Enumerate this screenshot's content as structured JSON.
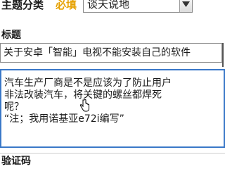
{
  "form": {
    "topic_label": "主题分类",
    "required_label": "必填",
    "topic_select": {
      "value": "谈天说地"
    },
    "title_label": "标题",
    "title_input": {
      "value": "关于安卓「智能」电视不能安装自己的软件"
    },
    "body_lines": [
      "汽车生产厂商是不是应该为了防止用户",
      "非法改装汽车，将关键的螺丝都焊死",
      "呢？",
      "“注；我用诺基亚e72i编写”"
    ],
    "captcha_label": "验证码"
  },
  "colors": {
    "required": "#e6a100",
    "focus_border": "#3a78c8"
  },
  "icons": {
    "select_arrow": "chevron-down-icon",
    "cursor": "hand-pointer-icon"
  }
}
